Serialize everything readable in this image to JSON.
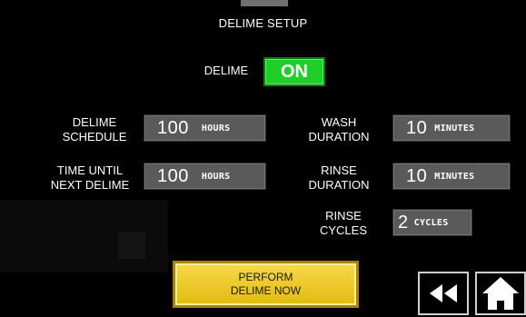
{
  "header": {
    "title": "DELIME SETUP"
  },
  "delime": {
    "label": "DELIME",
    "state": "ON"
  },
  "settings": {
    "delime_schedule": {
      "label1": "DELIME",
      "label2": "SCHEDULE",
      "value": "100",
      "unit": "HOURS"
    },
    "time_until": {
      "label1": "TIME UNTIL",
      "label2": "NEXT DELIME",
      "value": "100",
      "unit": "HOURS"
    },
    "wash": {
      "label1": "WASH",
      "label2": "DURATION",
      "value": "10",
      "unit": "MINUTES"
    },
    "rinse": {
      "label1": "RINSE",
      "label2": "DURATION",
      "value": "10",
      "unit": "MINUTES"
    },
    "rinse_cycles": {
      "label1": "RINSE",
      "label2": "CYCLES",
      "value": "2",
      "unit": "CYCLES"
    }
  },
  "actions": {
    "perform_line1": "PERFORM",
    "perform_line2": "DELIME NOW"
  },
  "nav": {
    "back_icon": "rewind-icon",
    "home_icon": "home-icon"
  },
  "colors": {
    "toggle_on": "#1fcf27",
    "perform_bg": "#f0c92a",
    "value_box": "#5a5a5a"
  }
}
